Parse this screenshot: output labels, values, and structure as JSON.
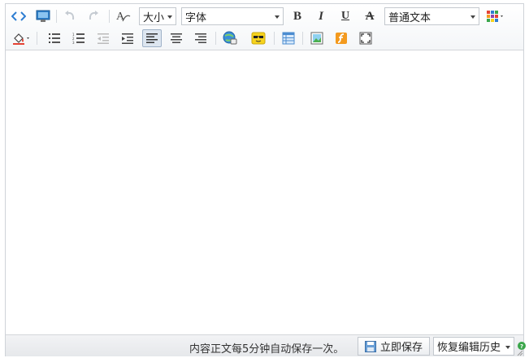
{
  "toolbar": {
    "size_label": "大小",
    "font_label": "字体",
    "format_label": "普通文本",
    "bold_label": "B",
    "italic_label": "I",
    "underline_label": "U",
    "strike_label": "A",
    "icons": [
      "source-code-icon",
      "preview-icon",
      "undo-icon",
      "redo-icon",
      "clear-format-icon",
      "bold-icon",
      "italic-icon",
      "underline-icon",
      "strikethrough-icon",
      "text-color-icon",
      "fill-color-icon",
      "bullet-list-icon",
      "numbered-list-icon",
      "outdent-icon",
      "indent-icon",
      "align-left-icon",
      "align-center-icon",
      "align-right-icon",
      "link-icon",
      "emoticon-icon",
      "table-icon",
      "image-icon",
      "flash-icon",
      "fullscreen-icon"
    ],
    "active_button": "align-left"
  },
  "statusbar": {
    "autosave_text": "内容正文每5分钟自动保存一次。",
    "save_now_label": "立即保存",
    "history_label": "恢复编辑历史"
  },
  "colors": {
    "toolbar_bg": "#f4f6f8",
    "border": "#cfd3d8",
    "accent_blue": "#2d7dd2",
    "flash_orange": "#f39a1e",
    "emoticon_yellow": "#f7d31c",
    "help_green": "#3aa64a"
  }
}
